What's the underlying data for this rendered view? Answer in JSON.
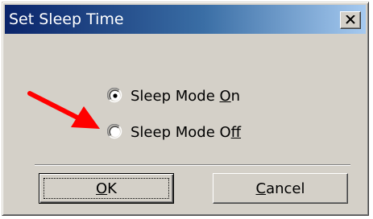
{
  "window": {
    "title": "Set Sleep Time"
  },
  "options": [
    {
      "label_pre": "Sleep Mode ",
      "label_mnemonic": "O",
      "label_post": "n",
      "selected": true
    },
    {
      "label_pre": "Sleep Mode O",
      "label_mnemonic": "f",
      "label_post": "f",
      "selected": false
    }
  ],
  "buttons": {
    "ok_mnemonic": "O",
    "ok_rest": "K",
    "cancel_mnemonic": "C",
    "cancel_rest": "ancel"
  },
  "colors": {
    "title_gradient_start": "#0a246a",
    "title_gradient_end": "#a6caf0",
    "dialog_face": "#d4d0c8",
    "annotation_arrow": "#ff0000"
  },
  "icons": {
    "close": "close-icon",
    "annotation": "red-arrow-icon"
  }
}
